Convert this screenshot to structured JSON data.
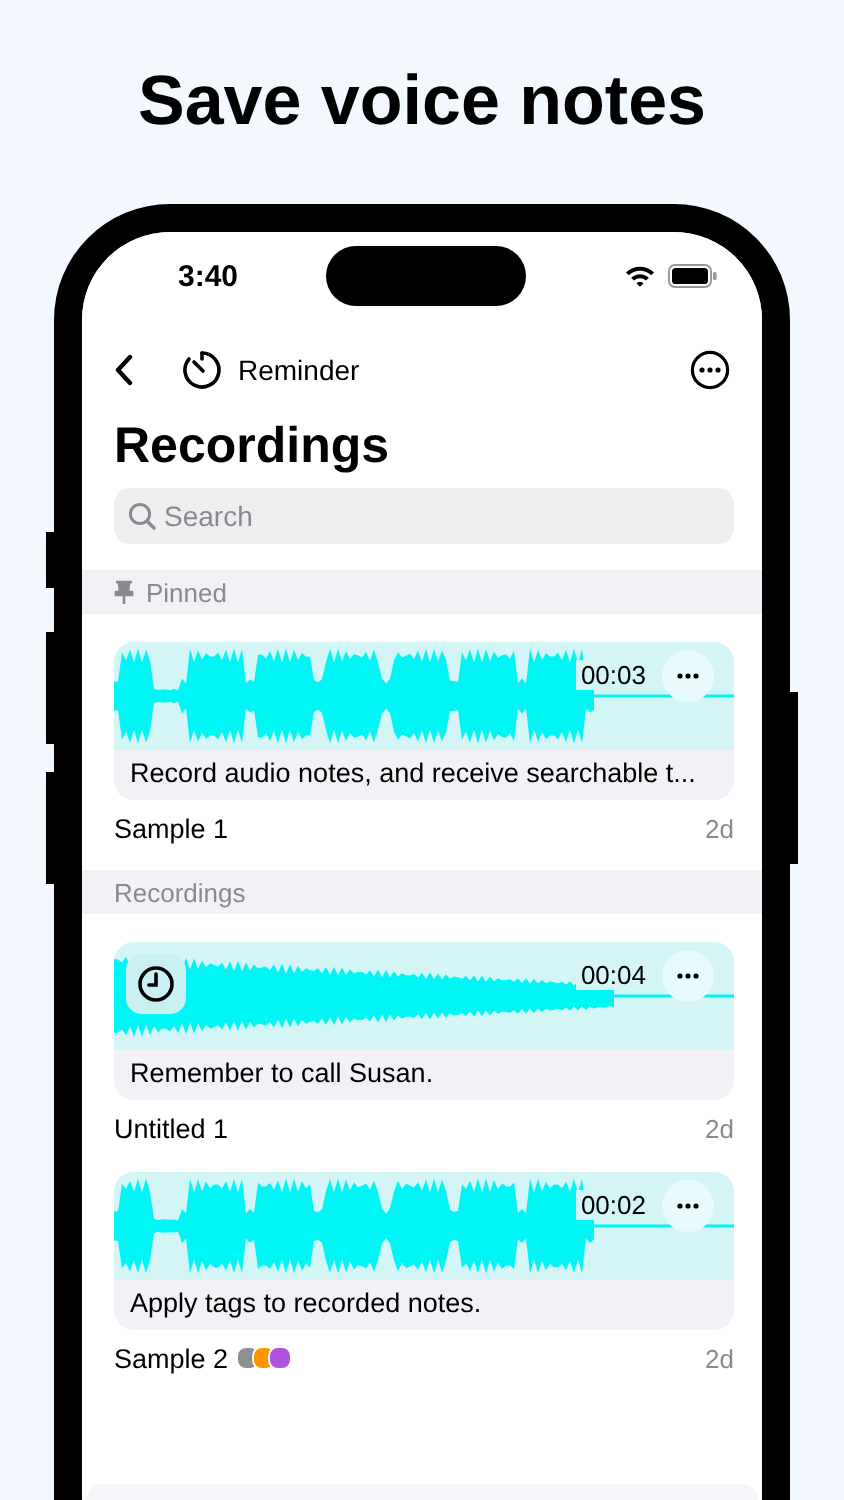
{
  "headline": "Save voice notes",
  "status_bar": {
    "time": "3:40"
  },
  "nav": {
    "title": "Reminder"
  },
  "page_title": "Recordings",
  "search": {
    "placeholder": "Search"
  },
  "sections": [
    {
      "title": "Pinned",
      "pinned": true,
      "items": [
        {
          "title": "Sample 1",
          "date": "2d",
          "duration": "00:03",
          "note": "Record audio notes, and receive searchable t...",
          "alarm": false
        }
      ]
    },
    {
      "title": "Recordings",
      "pinned": false,
      "items": [
        {
          "title": "Untitled 1",
          "date": "2d",
          "duration": "00:04",
          "note": "Remember to call Susan.",
          "alarm": true
        },
        {
          "title": "Sample 2",
          "date": "2d",
          "duration": "00:02",
          "note": "Apply tags to recorded notes.",
          "alarm": false,
          "tags": [
            {
              "color": "#8e8e93"
            },
            {
              "color": "#ff9500"
            },
            {
              "color": "#af52de"
            }
          ]
        }
      ]
    }
  ]
}
